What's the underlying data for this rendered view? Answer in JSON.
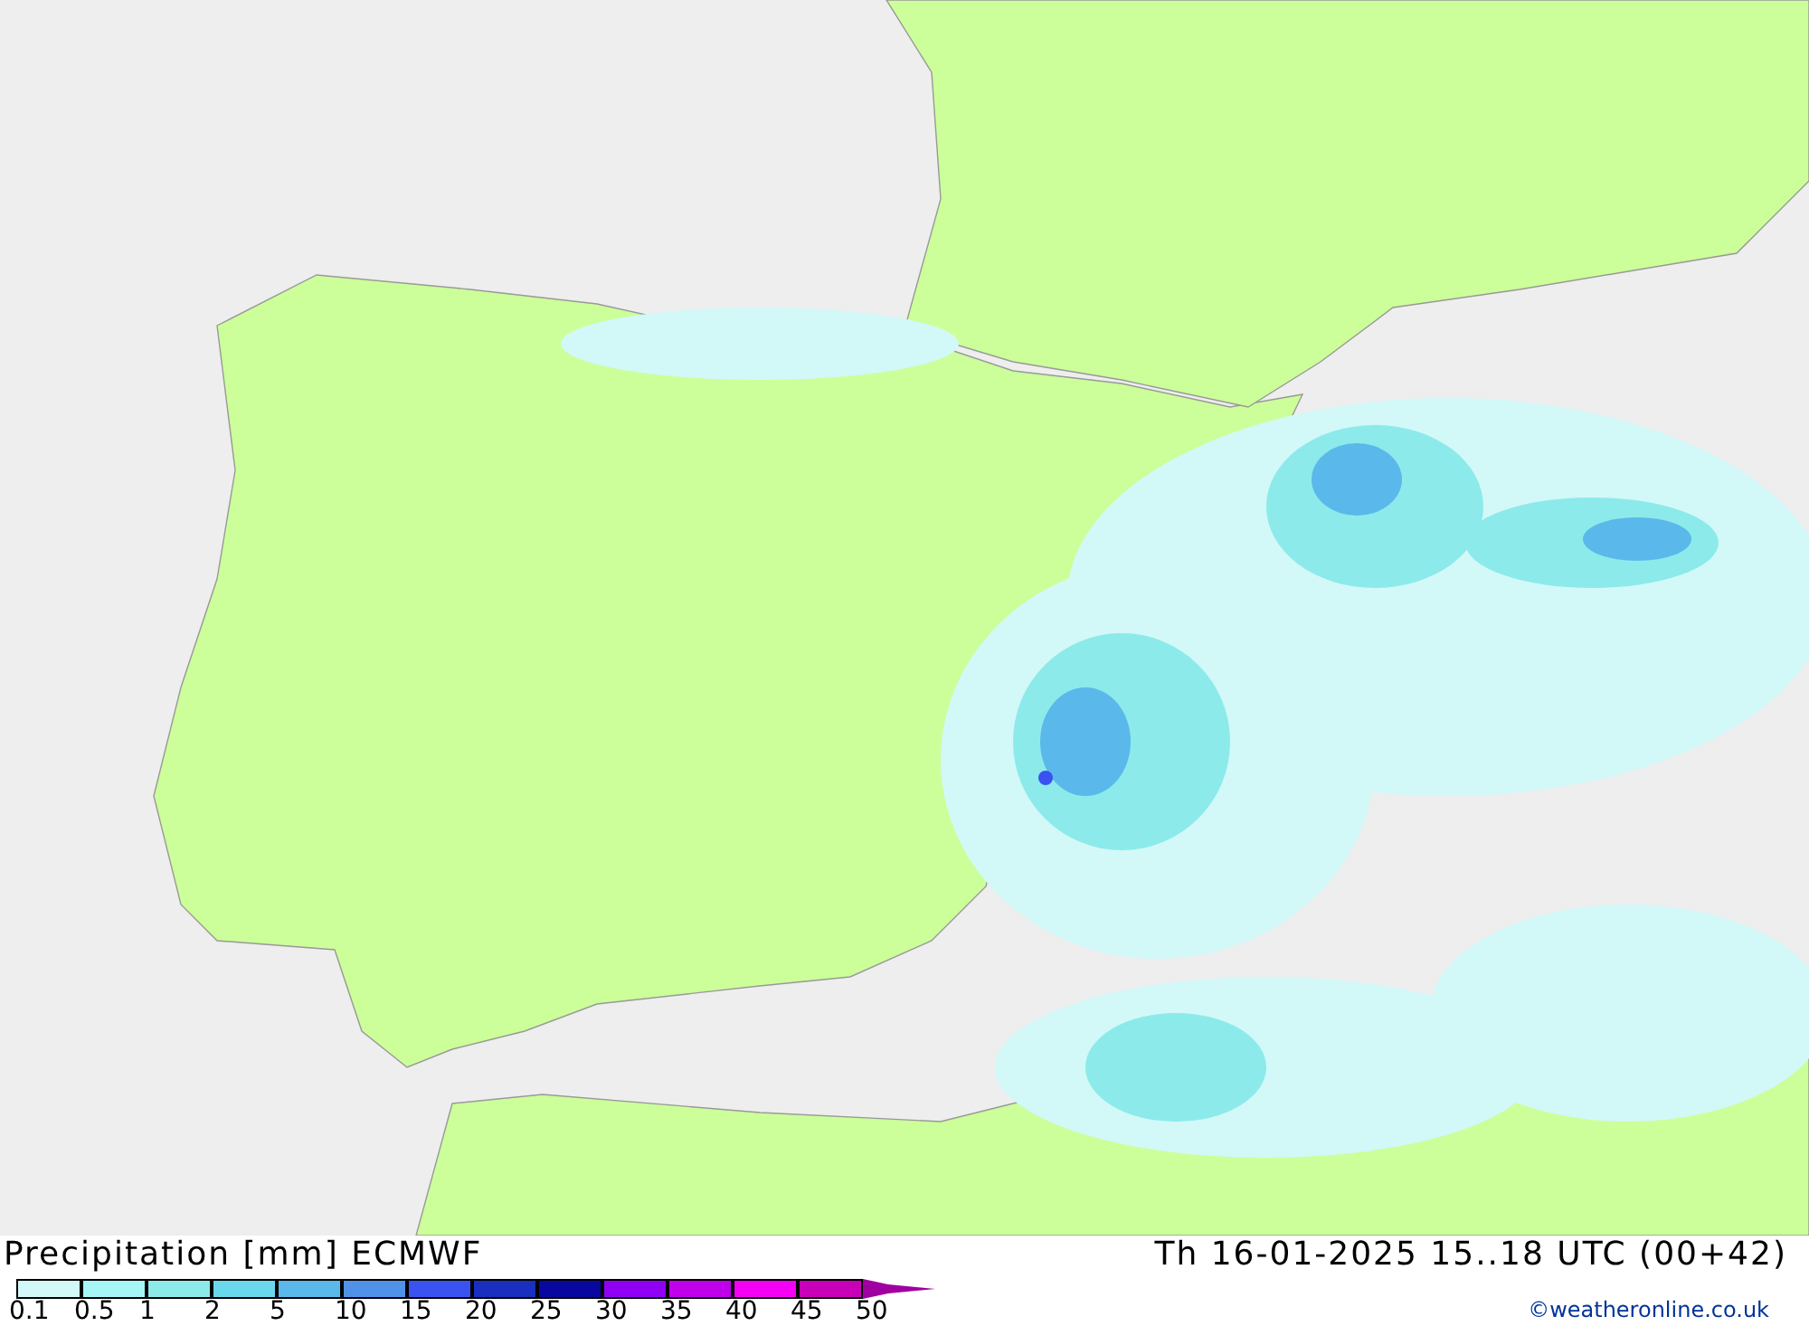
{
  "title": {
    "left": "Precipitation [mm] ECMWF",
    "right": "Th 16-01-2025 15..18 UTC (00+42)"
  },
  "legend": {
    "bins": [
      {
        "label": "0.1",
        "color": "#d2f8f8"
      },
      {
        "label": "0.5",
        "color": "#a6f6f6"
      },
      {
        "label": "1",
        "color": "#8ceaea"
      },
      {
        "label": "2",
        "color": "#6ad8ec"
      },
      {
        "label": "5",
        "color": "#5ab8ea"
      },
      {
        "label": "10",
        "color": "#5092e8"
      },
      {
        "label": "15",
        "color": "#3a52f0"
      },
      {
        "label": "20",
        "color": "#1a2ec0"
      },
      {
        "label": "25",
        "color": "#0808a0"
      },
      {
        "label": "30",
        "color": "#9000f4"
      },
      {
        "label": "35",
        "color": "#c000ea"
      },
      {
        "label": "40",
        "color": "#f400f4"
      },
      {
        "label": "45",
        "color": "#c800b8"
      }
    ],
    "end_label": "50",
    "arrow": {
      "color": "#a000a0"
    }
  },
  "credit": "©weatheronline.co.uk"
}
